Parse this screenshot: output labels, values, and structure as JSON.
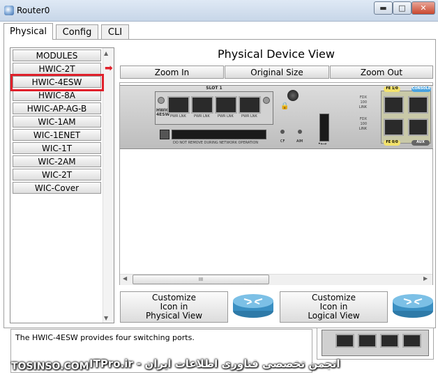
{
  "window": {
    "title": "Router0",
    "minimize_glyph": "▬",
    "maximize_glyph": "□",
    "close_glyph": "✕"
  },
  "tabs": [
    {
      "label": "Physical",
      "active": true
    },
    {
      "label": "Config",
      "active": false
    },
    {
      "label": "CLI",
      "active": false
    }
  ],
  "modules": {
    "items": [
      "MODULES",
      "HWIC-2T",
      "HWIC-4ESW",
      "HWIC-8A",
      "HWIC-AP-AG-B",
      "WIC-1AM",
      "WIC-1ENET",
      "WIC-1T",
      "WIC-2AM",
      "WIC-2T",
      "WIC-Cover"
    ],
    "selected": "HWIC-4ESW",
    "highlight_color": "#e0202a"
  },
  "view": {
    "title": "Physical Device View",
    "zoom_in": "Zoom In",
    "original_size": "Original Size",
    "zoom_out": "Zoom Out"
  },
  "device": {
    "slot_label": "SLOT 1",
    "card_label_1": "HWIC",
    "card_label_2": "4ESW",
    "port_label": "PWR LNK",
    "warning": "DO NOT REMOVE DURING NETWORK OPERATION",
    "cf_label": "CF",
    "aim_label": "AIM",
    "usb_label": "•⟷",
    "fdx_labels": [
      "FDX",
      "100",
      "LINK"
    ],
    "fe10": "FE 1/0",
    "console": "CONSOLE",
    "fe00": "FE 0/0",
    "aux": "AUX"
  },
  "scroll": {
    "thumb_glyph": "III"
  },
  "customize": {
    "physical_label": "Customize\nIcon in\nPhysical View",
    "physical_lines": [
      "Customize",
      "Icon in",
      "Physical View"
    ],
    "logical_lines": [
      "Customize",
      "Icon in",
      "Logical View"
    ]
  },
  "info": {
    "description": "The HWIC-4ESW provides four switching ports."
  },
  "watermark": {
    "left": "TOSINSO.COM",
    "right": "ITPro.ir - انجمن تخصصی فناوری اطلاعات ایران"
  },
  "colors": {
    "close_button": "#c9482f",
    "fe_tag": "#f3e26b",
    "console_tag": "#4aa3df"
  }
}
